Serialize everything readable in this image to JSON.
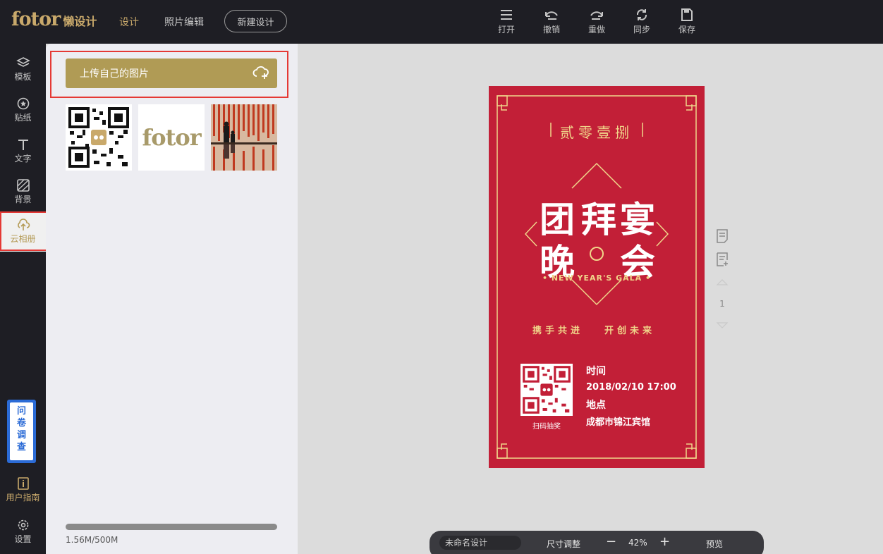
{
  "topbar": {
    "brand": "fotor",
    "brand_sub": "懒设计",
    "nav_design": "设计",
    "nav_photo": "照片编辑",
    "new_design": "新建设计",
    "tools": [
      {
        "label": "打开",
        "icon": "menu-icon"
      },
      {
        "label": "撤销",
        "icon": "undo-icon"
      },
      {
        "label": "重做",
        "icon": "redo-icon"
      },
      {
        "label": "同步",
        "icon": "sync-icon"
      },
      {
        "label": "保存",
        "icon": "save-icon"
      }
    ]
  },
  "leftnav": {
    "items": [
      {
        "label": "模板",
        "icon": "layers-icon"
      },
      {
        "label": "贴纸",
        "icon": "star-icon"
      },
      {
        "label": "文字",
        "icon": "text-icon"
      },
      {
        "label": "背景",
        "icon": "background-icon"
      },
      {
        "label": "云相册",
        "icon": "cloud-upload-icon",
        "active": true
      }
    ],
    "survey": [
      "问",
      "卷",
      "调",
      "查"
    ],
    "guide": "用户指南",
    "settings": "设置"
  },
  "panel": {
    "upload_label": "上传自己的图片",
    "thumb_brand": "fotor",
    "storage_text": "1.56M/500M",
    "storage_used_fraction": 0.003
  },
  "poster": {
    "year_text": "贰零壹捌",
    "title_chars": [
      "团",
      "拜",
      "宴",
      "晚",
      "会"
    ],
    "subtitle_en": "NEW YEAR'S GALA",
    "slogan_left": "携手共进",
    "slogan_right": "开创未来",
    "qr_caption": "扫码抽奖",
    "time_label": "时间",
    "time_value": "2018/02/10 17:00",
    "place_label": "地点",
    "place_value": "成都市锦江宾馆"
  },
  "page_nav": {
    "page_number": "1"
  },
  "bottombar": {
    "design_name": "未命名设计",
    "resize": "尺寸调整",
    "zoom": "42%",
    "preview": "预览"
  },
  "colors": {
    "dark_bg": "#1e1e24",
    "gold": "#b09b55",
    "poster_red": "#c21f37",
    "poster_gold": "#f0d58a"
  }
}
